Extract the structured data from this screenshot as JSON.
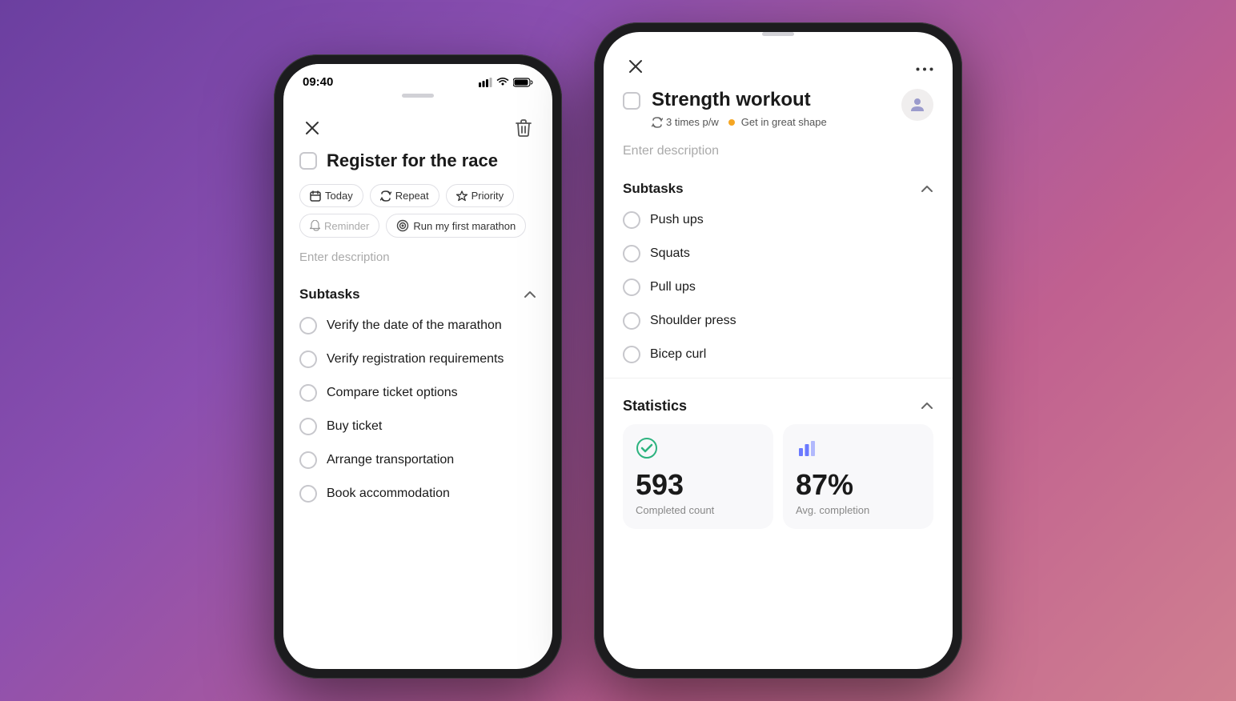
{
  "phone1": {
    "statusBar": {
      "time": "09:40"
    },
    "topBar": {
      "closeLabel": "×",
      "deleteLabel": "🗑"
    },
    "task": {
      "title": "Register for the race",
      "tags": [
        {
          "id": "today",
          "icon": "calendar",
          "label": "Today"
        },
        {
          "id": "repeat",
          "icon": "repeat",
          "label": "Repeat"
        },
        {
          "id": "priority",
          "icon": "star",
          "label": "Priority"
        }
      ],
      "reminderTag": {
        "icon": "bell",
        "label": "Reminder"
      },
      "goalTag": {
        "icon": "goal",
        "label": "Run my first marathon"
      },
      "descriptionPlaceholder": "Enter description",
      "subtasksLabel": "Subtasks",
      "subtasks": [
        "Verify the date of the marathon",
        "Verify registration requirements",
        "Compare ticket options",
        "Buy ticket",
        "Arrange transportation",
        "Book accommodation"
      ]
    }
  },
  "phone2": {
    "topBar": {
      "closeLabel": "×",
      "moreLabel": "···"
    },
    "task": {
      "title": "Strength workout",
      "metaRepeat": "3 times p/w",
      "metaGoal": "Get in great shape",
      "descriptionPlaceholder": "Enter description",
      "subtasksLabel": "Subtasks",
      "subtasks": [
        "Push ups",
        "Squats",
        "Pull ups",
        "Shoulder press",
        "Bicep curl"
      ]
    },
    "statistics": {
      "label": "Statistics",
      "completedCount": "593",
      "completedLabel": "Completed count",
      "avgCompletion": "87%",
      "avgLabel": "Avg. completion"
    }
  }
}
